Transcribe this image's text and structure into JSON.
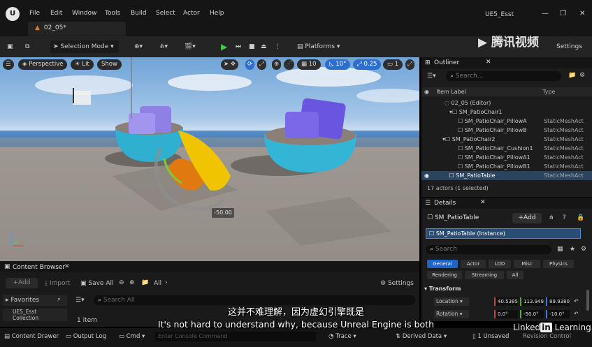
{
  "menu": [
    "File",
    "Edit",
    "Window",
    "Tools",
    "Build",
    "Select",
    "Actor",
    "Help"
  ],
  "window_title": "UE5_Esst",
  "project_tab": "02_05*",
  "toolbar": {
    "mode_label": "Selection Mode",
    "platforms_label": "Platforms",
    "settings_label": "Settings"
  },
  "viewport": {
    "perspective": "Perspective",
    "lit": "Lit",
    "show": "Show",
    "grid_snap": "10",
    "rotation_snap": "10°",
    "scale_snap": "0.25",
    "camera_speed": "1",
    "angle_readout": "-50.00"
  },
  "outliner": {
    "title": "Outliner",
    "search_placeholder": "Search...",
    "col_label": "Item Label",
    "col_type": "Type",
    "rows": [
      {
        "label": "02_05 (Editor)",
        "type": ""
      },
      {
        "label": "SM_PatioChair1",
        "type": ""
      },
      {
        "label": "SM_PatioChair_PillowA",
        "type": "StaticMeshAct"
      },
      {
        "label": "SM_PatioChair_PillowB",
        "type": "StaticMeshAct"
      },
      {
        "label": "SM_PatioChair2",
        "type": "StaticMeshAct"
      },
      {
        "label": "SM_PatioChair_Cushion1",
        "type": "StaticMeshAct"
      },
      {
        "label": "SM_PatioChair_PillowA1",
        "type": "StaticMeshAct"
      },
      {
        "label": "SM_PatioChair_PillowB1",
        "type": "StaticMeshAct"
      },
      {
        "label": "SM_PatioTable",
        "type": "StaticMeshAct"
      }
    ],
    "count": "17 actors (1 selected)"
  },
  "details": {
    "title": "Details",
    "actor_name": "SM_PatioTable",
    "add_label": "+Add",
    "instance": "SM_PatioTable (Instance)",
    "search_placeholder": "Search",
    "categories_row1": [
      "General",
      "Actor",
      "LOD",
      "Misc",
      "Physics"
    ],
    "categories_row2": [
      "Rendering",
      "Streaming",
      "All"
    ],
    "section": "Transform",
    "location_label": "Location",
    "rotation_label": "Rotation",
    "location": [
      "40.5385",
      "113.949",
      "89.9380"
    ],
    "rotation": [
      "0.0°",
      "-50.0°",
      "-10.0°"
    ]
  },
  "content_browser": {
    "title": "Content Browser",
    "add": "+Add",
    "import": "Import",
    "save_all": "Save All",
    "path": "All",
    "settings": "Settings",
    "favorites": "Favorites",
    "collection": "UE5_Esst",
    "collection_sub": "Collection",
    "search_placeholder": "Search All",
    "item_count": "1 item"
  },
  "statusbar": {
    "content_drawer": "Content Drawer",
    "output_log": "Output Log",
    "cmd": "Cmd",
    "console_placeholder": "Enter Console Command",
    "trace": "Trace",
    "derived_data": "Derived Data",
    "unsaved": "1 Unsaved",
    "revision": "Revision Control"
  },
  "subtitle_cn": "这并不难理解，因为虚幻引擎既是",
  "subtitle_en": "It's not hard to understand why, because Unreal Engine is both",
  "watermark": "腾讯视频",
  "linkedin": [
    "Linked",
    "in",
    " Learning"
  ]
}
